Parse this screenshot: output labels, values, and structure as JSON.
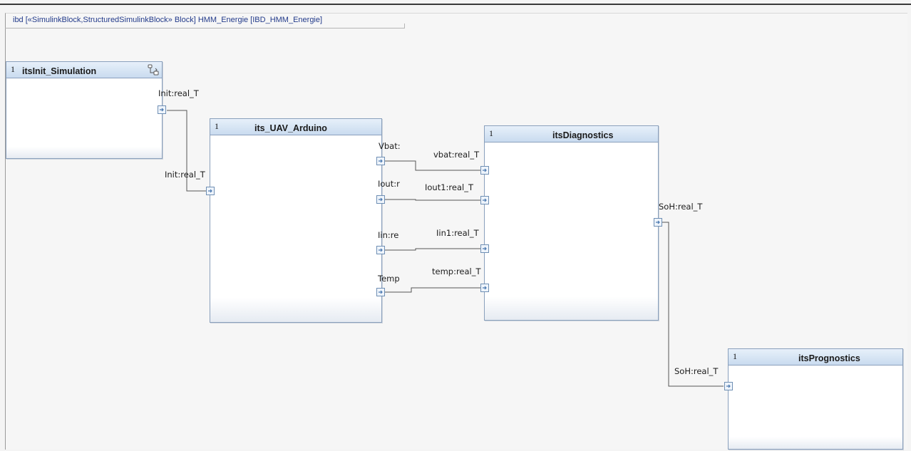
{
  "diagram": {
    "frame_title": "ibd [«SimulinkBlock,StructuredSimulinkBlock» Block] HMM_Energie [IBD_HMM_Energie]",
    "blocks": {
      "init_sim": {
        "multiplicity": "1",
        "name": "itsInit_Simulation"
      },
      "arduino": {
        "multiplicity": "1",
        "name": "its_UAV_Arduino"
      },
      "diagnostics": {
        "multiplicity": "1",
        "name": "itsDiagnostics"
      },
      "prognostics": {
        "multiplicity": "1",
        "name": "itsPrognostics"
      }
    },
    "ports": {
      "init_out": "Init:real_T",
      "arduino_init_in": "Init:real_T",
      "vbat_out": "Vbat:",
      "iout_out": "Iout:r",
      "iin_out": "Iin:re",
      "temp_out": "Temp",
      "vbat_in": "vbat:real_T",
      "iout1_in": "Iout1:real_T",
      "iin1_in": "Iin1:real_T",
      "temp_in": "temp:real_T",
      "soh_out": "SoH:real_T",
      "soh_in": "SoH:real_T"
    },
    "colors": {
      "header_top": "#e7f0fa",
      "header_bottom": "#c9dbef",
      "block_border": "#8aa0bc",
      "title_text": "#223a8a",
      "connector": "#555555"
    }
  }
}
